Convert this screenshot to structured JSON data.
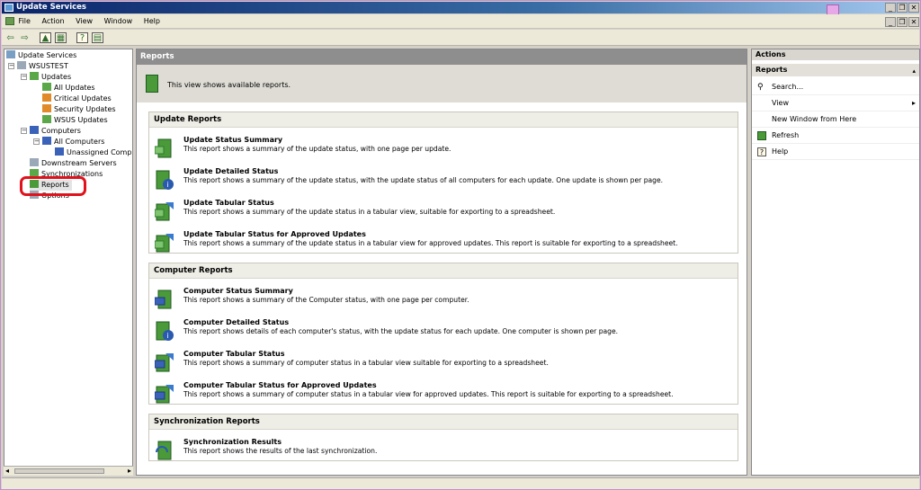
{
  "window": {
    "title": "Update Services"
  },
  "menu": [
    "File",
    "Action",
    "View",
    "Window",
    "Help"
  ],
  "tree": {
    "root": "Update Services",
    "server": "WSUSTEST",
    "updates": "Updates",
    "all_updates": "All Updates",
    "critical_updates": "Critical Updates",
    "security_updates": "Security Updates",
    "wsus_updates": "WSUS Updates",
    "computers": "Computers",
    "all_computers": "All Computers",
    "unassigned": "Unassigned Computers",
    "downstream": "Downstream Servers",
    "synchronizations": "Synchronizations",
    "reports": "Reports",
    "options": "Options"
  },
  "main": {
    "header": "Reports",
    "info": "This view shows available reports.",
    "sections": [
      {
        "title": "Update Reports",
        "items": [
          {
            "title": "Update Status Summary",
            "desc": "This report shows a summary of the update status, with one page per update."
          },
          {
            "title": "Update Detailed Status",
            "desc": "This report shows a summary of the update status, with the update status of all computers for each update. One update is shown per page."
          },
          {
            "title": "Update Tabular Status",
            "desc": "This report shows a summary of the update status in a tabular view, suitable for exporting to a spreadsheet."
          },
          {
            "title": "Update Tabular Status for Approved Updates",
            "desc": "This report shows a summary of the update status in a tabular view for approved updates. This report is suitable for exporting to a spreadsheet."
          }
        ]
      },
      {
        "title": "Computer Reports",
        "items": [
          {
            "title": "Computer Status Summary",
            "desc": "This report shows a summary of the Computer status, with one page per computer."
          },
          {
            "title": "Computer Detailed Status",
            "desc": "This report shows details of each computer's status, with the update status for each update. One computer is shown per page."
          },
          {
            "title": "Computer Tabular Status",
            "desc": "This report shows a summary of computer status in a tabular view suitable for exporting to a spreadsheet."
          },
          {
            "title": "Computer Tabular Status for Approved Updates",
            "desc": "This report shows a summary of computer status in a tabular view for approved updates. This report is suitable for exporting to a spreadsheet."
          }
        ]
      },
      {
        "title": "Synchronization Reports",
        "items": [
          {
            "title": "Synchronization Results",
            "desc": "This report shows the results of the last synchronization."
          }
        ]
      }
    ]
  },
  "actions": {
    "header": "Actions",
    "section": "Reports",
    "items": [
      "Search...",
      "View",
      "New Window from Here",
      "Refresh",
      "Help"
    ]
  },
  "colors": {
    "highlight": "#e0121c",
    "report_icon": "#4a9a3a",
    "title_bar": "#0a246a"
  }
}
